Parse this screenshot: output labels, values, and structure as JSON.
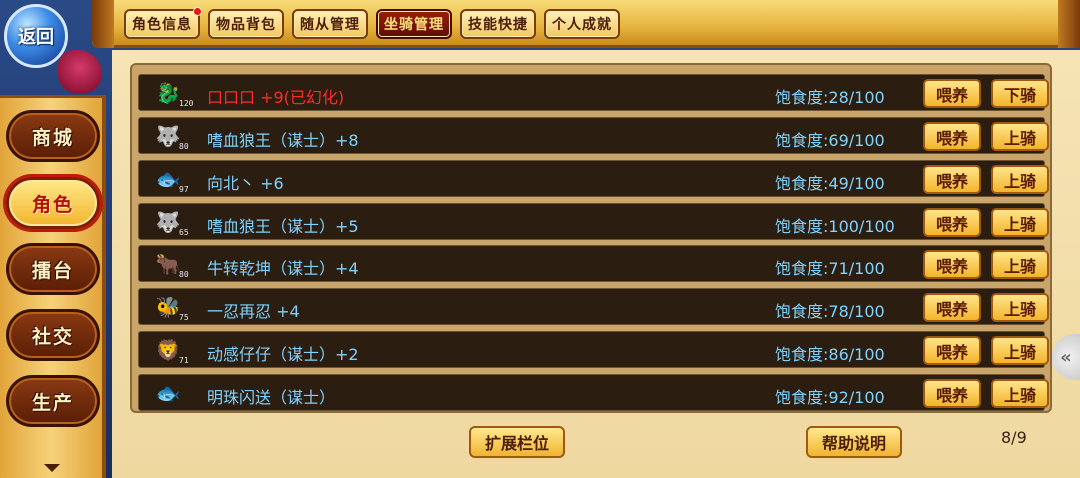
{
  "back_button": {
    "label": "返回"
  },
  "tabs": [
    {
      "label": "角色信息",
      "has_dot": true
    },
    {
      "label": "物品背包"
    },
    {
      "label": "随从管理"
    },
    {
      "label": "坐骑管理",
      "active": true
    },
    {
      "label": "技能快捷"
    },
    {
      "label": "个人成就"
    }
  ],
  "sidebar": {
    "items": [
      {
        "label": "商城"
      },
      {
        "label": "角色",
        "active": true
      },
      {
        "label": "擂台"
      },
      {
        "label": "社交"
      },
      {
        "label": "生产"
      }
    ]
  },
  "mounts": [
    {
      "icon": "dragon-mount-icon",
      "glyph": "🐉",
      "level": "120",
      "name": "口口口 +9(已幻化)",
      "name_red": true,
      "satiety": "饱食度:28/100",
      "feed": "喂养",
      "ride": "下骑"
    },
    {
      "icon": "wolf-mount-icon",
      "glyph": "🐺",
      "level": "80",
      "name": "嗜血狼王（谋士）+8",
      "satiety": "饱食度:69/100",
      "feed": "喂养",
      "ride": "上骑"
    },
    {
      "icon": "fish-mount-icon",
      "glyph": "🐟",
      "level": "97",
      "name": "向北丶 +6",
      "satiety": "饱食度:49/100",
      "feed": "喂养",
      "ride": "上骑"
    },
    {
      "icon": "wolf-mount-icon",
      "glyph": "🐺",
      "level": "65",
      "name": "嗜血狼王（谋士）+5",
      "satiety": "饱食度:100/100",
      "feed": "喂养",
      "ride": "上骑"
    },
    {
      "icon": "ox-mount-icon",
      "glyph": "🐂",
      "level": "80",
      "name": "牛转乾坤（谋士）+4",
      "satiety": "饱食度:71/100",
      "feed": "喂养",
      "ride": "上骑"
    },
    {
      "icon": "bee-mount-icon",
      "glyph": "🐝",
      "level": "75",
      "name": "一忍再忍  +4",
      "satiety": "饱食度:78/100",
      "feed": "喂养",
      "ride": "上骑"
    },
    {
      "icon": "beast-mount-icon",
      "glyph": "🦁",
      "level": "71",
      "name": "动感仔仔（谋士）+2",
      "satiety": "饱食度:86/100",
      "feed": "喂养",
      "ride": "上骑"
    },
    {
      "icon": "fish-mount-icon",
      "glyph": "🐟",
      "level": "",
      "name": "明珠闪送（谋士）",
      "satiety": "饱食度:92/100",
      "feed": "喂养",
      "ride": "上骑"
    }
  ],
  "bottom": {
    "expand_label": "扩展栏位",
    "help_label": "帮助说明",
    "page": "8/9"
  },
  "side_toggle": "«"
}
